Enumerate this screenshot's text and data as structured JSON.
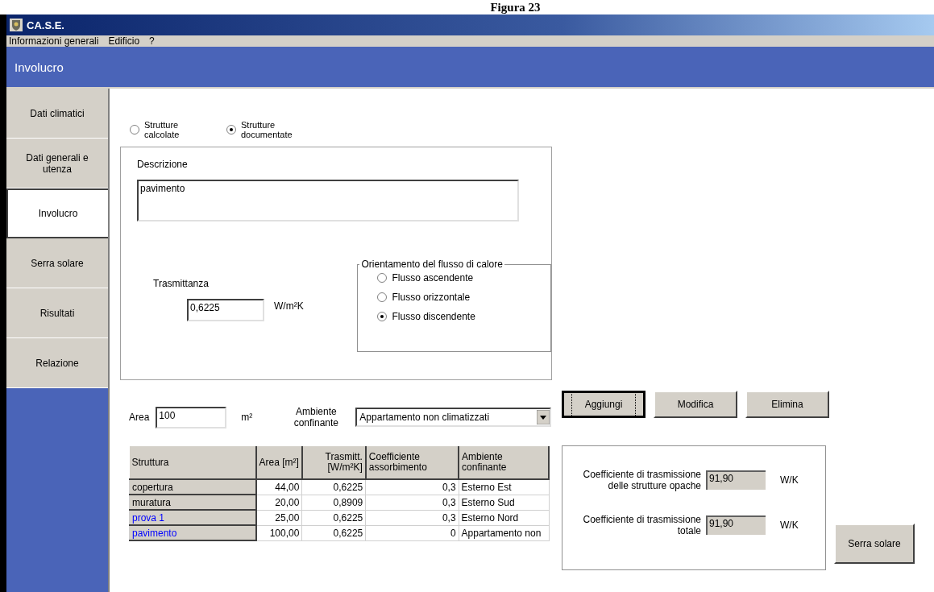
{
  "document_caption": "Figura 23",
  "window": {
    "title": "CA.S.E."
  },
  "menu": [
    "Informazioni generali",
    "Edificio",
    "?"
  ],
  "header": {
    "title": "Involucro"
  },
  "sidebar": {
    "items": [
      {
        "label": "Dati climatici",
        "selected": false
      },
      {
        "label": "Dati generali e utenza",
        "selected": false
      },
      {
        "label": "Involucro",
        "selected": true
      },
      {
        "label": "Serra solare",
        "selected": false
      },
      {
        "label": "Risultati",
        "selected": false
      },
      {
        "label": "Relazione",
        "selected": false
      }
    ]
  },
  "structure_type": [
    {
      "label": "Strutture calcolate",
      "selected": false
    },
    {
      "label": "Strutture documentate",
      "selected": true
    }
  ],
  "description": {
    "label": "Descrizione",
    "value": "pavimento"
  },
  "transmittance": {
    "label": "Trasmittanza",
    "value": "0,6225",
    "unit": "W/m²K"
  },
  "heat_flow": {
    "title": "Orientamento del flusso di calore",
    "options": [
      {
        "label": "Flusso ascendente",
        "selected": false
      },
      {
        "label": "Flusso orizzontale",
        "selected": false
      },
      {
        "label": "Flusso discendente",
        "selected": true
      }
    ]
  },
  "area": {
    "label": "Area",
    "value": "100",
    "unit": "m²"
  },
  "adjacent": {
    "label": "Ambiente confinante",
    "value": "Appartamento non climatizzati"
  },
  "buttons": [
    {
      "label": "Aggiungi",
      "focused": true
    },
    {
      "label": "Modifica",
      "focused": false
    },
    {
      "label": "Elimina",
      "focused": false
    }
  ],
  "table": {
    "columns": [
      "Struttura",
      "Area [m²]",
      "Trasmitt. [W/m²K]",
      "Coefficiente assorbimento",
      "Ambiente confinante"
    ],
    "rows": [
      {
        "color": "#000000",
        "cells": [
          "copertura",
          "44,00",
          "0,6225",
          "0,3",
          "Esterno Est"
        ]
      },
      {
        "color": "#000000",
        "cells": [
          "muratura",
          "20,00",
          "0,8909",
          "0,3",
          "Esterno Sud"
        ]
      },
      {
        "color": "#0000ff",
        "cells": [
          "prova 1",
          "25,00",
          "0,6225",
          "0,3",
          "Esterno Nord"
        ]
      },
      {
        "color": "#0000ff",
        "cells": [
          "pavimento",
          "100,00",
          "0,6225",
          "0",
          "Appartamento non"
        ]
      }
    ]
  },
  "results": [
    {
      "label": "Coefficiente di trasmissione delle strutture opache",
      "value": "91,90",
      "unit": "W/K"
    },
    {
      "label": "Coefficiente di trasmissione totale",
      "value": "91,90",
      "unit": "W/K"
    }
  ],
  "side_button": "Serra solare"
}
